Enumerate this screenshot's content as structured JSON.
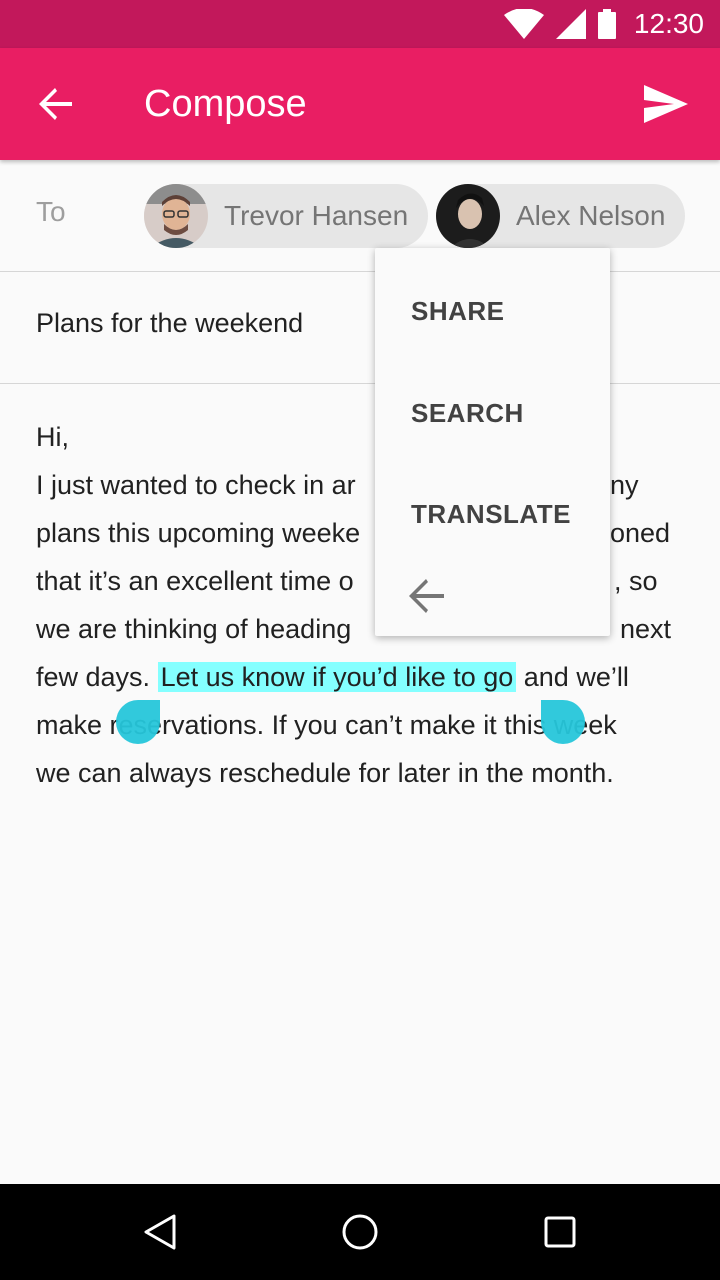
{
  "status_bar": {
    "time": "12:30",
    "icons": [
      "wifi-icon",
      "signal-icon",
      "battery-icon"
    ]
  },
  "app_bar": {
    "title": "Compose",
    "back_icon": "arrow-back-icon",
    "send_icon": "send-icon"
  },
  "to": {
    "label": "To",
    "recipients": [
      {
        "name": "Trevor Hansen"
      },
      {
        "name": "Alex Nelson"
      }
    ]
  },
  "subject": "Plans for the weekend",
  "body": {
    "lines": [
      "Hi,",
      "I just wanted to check in ar",
      "plans this upcoming weeke",
      "that it’s an excellent time o",
      "we are thinking of heading"
    ],
    "line6_before": "few days. ",
    "selected_text": "Let us know if you’d like to go",
    "line6_after": " and we’ll",
    "line7": "make reservations. If you can’t make it this week",
    "line8": "we can always reschedule for later in the month.",
    "partial_right": {
      "line2": "ny",
      "line3": "oned",
      "line4": ", so",
      "line5": "next"
    }
  },
  "context_menu": {
    "items": [
      "SHARE",
      "SEARCH",
      "TRANSLATE"
    ],
    "back_icon": "arrow-back-icon"
  },
  "colors": {
    "status_bar": "#c2185b",
    "app_bar": "#e91e63",
    "selection": "#84ffff",
    "handle": "#26c6da"
  },
  "nav_bar": {
    "icons": [
      "back-triangle-icon",
      "home-circle-icon",
      "recents-square-icon"
    ]
  }
}
